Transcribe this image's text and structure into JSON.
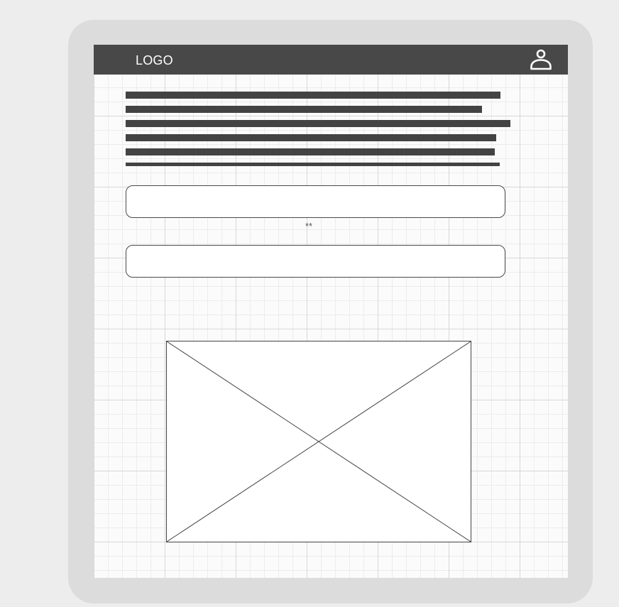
{
  "header": {
    "logo_text": "LOGO",
    "user_icon": "user-icon"
  },
  "text_block": {
    "line_count": 6
  },
  "form": {
    "field_1_value": "",
    "separator_text": "**",
    "field_2_value": ""
  },
  "media": {
    "image_icon": "image-placeholder-icon"
  },
  "colors": {
    "topbar": "#484848",
    "device_frame": "#dcdcdc",
    "page_background": "#ededed",
    "text_placeholder": "#434343"
  }
}
